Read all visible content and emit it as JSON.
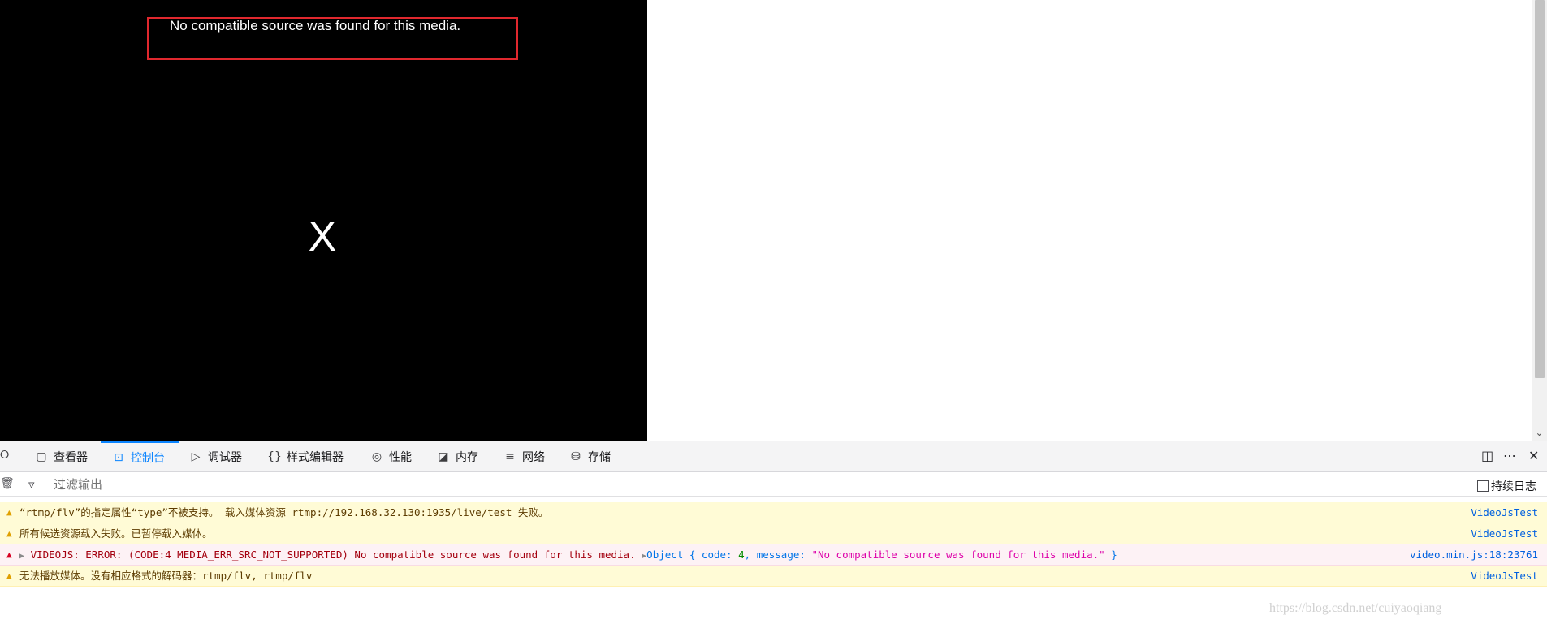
{
  "player": {
    "error_message": "No compatible source was found for this media.",
    "close_glyph": "X"
  },
  "devtools": {
    "tabs": [
      {
        "label": "查看器",
        "icon": "inspector-icon"
      },
      {
        "label": "控制台",
        "icon": "console-icon",
        "active": true
      },
      {
        "label": "调试器",
        "icon": "debugger-icon"
      },
      {
        "label": "样式编辑器",
        "icon": "style-editor-icon"
      },
      {
        "label": "性能",
        "icon": "performance-icon"
      },
      {
        "label": "内存",
        "icon": "memory-icon"
      },
      {
        "label": "网络",
        "icon": "network-icon"
      },
      {
        "label": "存储",
        "icon": "storage-icon"
      }
    ],
    "filter_placeholder": "过滤输出",
    "persist_logs_label": "持续日志",
    "accent_color": "#0a84ff",
    "logs": [
      {
        "level": "warning",
        "text": "“rtmp/flv”的指定属性“type”不被支持。 载入媒体资源 rtmp://192.168.32.130:1935/live/test 失败。",
        "source": "VideoJsTest"
      },
      {
        "level": "warning",
        "text": "所有候选资源载入失败。已暂停载入媒体。",
        "source": "VideoJsTest"
      },
      {
        "level": "error",
        "text": "VIDEOJS: ERROR: (CODE:4 MEDIA_ERR_SRC_NOT_SUPPORTED) No compatible source was found for this media.",
        "object_label": "Object",
        "object_code_key": "code:",
        "object_code_value": "4",
        "object_message_key": "message:",
        "object_message_value": "\"No compatible source was found for this media.\"",
        "source": "video.min.js:18:23761"
      },
      {
        "level": "warning",
        "text": "无法播放媒体。没有相应格式的解码器：rtmp/flv, rtmp/flv",
        "source": "VideoJsTest"
      }
    ]
  },
  "watermark": "https://blog.csdn.net/cuiyaoqiang"
}
